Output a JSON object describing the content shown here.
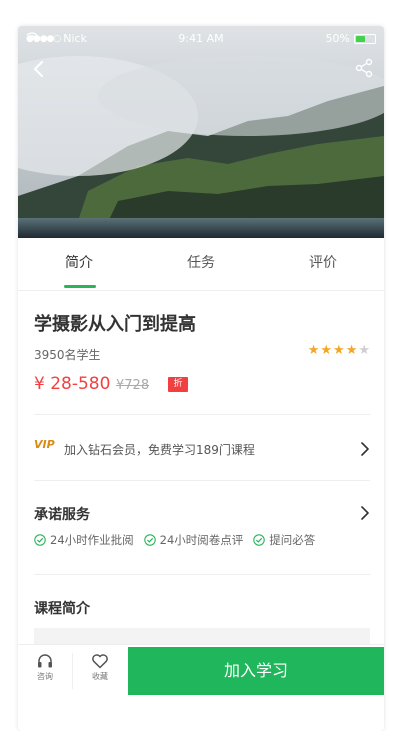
{
  "statusbar": {
    "carrier": "Nick",
    "time": "9:41 AM",
    "battery": "50%",
    "battery_level": 0.5
  },
  "header": {
    "back_icon": "chevron-left-icon",
    "share_icon": "share-icon"
  },
  "tabs": [
    {
      "label": "简介",
      "active": true
    },
    {
      "label": "任务",
      "active": false
    },
    {
      "label": "评价",
      "active": false
    }
  ],
  "course": {
    "title": "学摄影从入门到提高",
    "students": "3950名学生",
    "rating": 4,
    "rating_max": 5,
    "price": "¥ 28-580",
    "old_price": "¥728",
    "discount_badge": "折"
  },
  "vip": {
    "badge": "VIP",
    "text": "加入钻石会员，免费学习189门课程"
  },
  "promise": {
    "title": "承诺服务",
    "items": [
      "24小时作业批阅",
      "24小时阅卷点评",
      "提问必答"
    ]
  },
  "intro": {
    "title": "课程简介"
  },
  "bottom_bar": {
    "consult_label": "咨询",
    "favorite_label": "收藏",
    "join_label": "加入学习"
  },
  "colors": {
    "accent": "#1fb65c",
    "price": "#f24040",
    "star": "#f5a623",
    "vip": "#d98b17"
  }
}
